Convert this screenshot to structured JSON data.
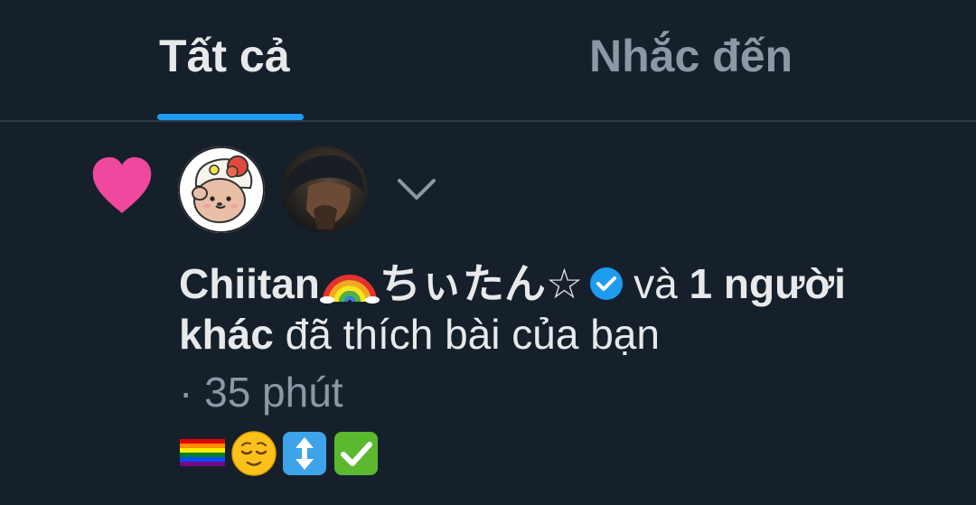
{
  "tabs": {
    "all": "Tất cả",
    "mentions": "Nhắc đến"
  },
  "notification": {
    "icon": "heart-icon",
    "avatars": [
      "avatar-chiitan",
      "avatar-other-user"
    ],
    "expand_icon": "chevron-down-icon",
    "user_name": "Chiitan",
    "user_suffix": "ちぃたん☆",
    "name_emoji": "rainbow-emoji",
    "verified_icon": "verified-badge-icon",
    "conjunction": "và",
    "others": "1 người khác",
    "action": "đã thích bài của bạn",
    "time_prefix": "·",
    "time": "35 phút",
    "post_emojis": [
      "rainbow-flag",
      "relieved-face",
      "up-down-arrow",
      "check-mark-button"
    ]
  },
  "colors": {
    "background": "#15202b",
    "accent": "#1d9bf0",
    "like": "#f0489e",
    "muted": "#8b98a5",
    "text": "#e7e9ea"
  }
}
